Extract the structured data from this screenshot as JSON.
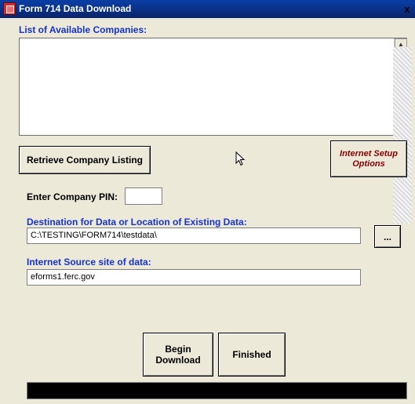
{
  "window": {
    "title": "Form 714 Data Download",
    "close_glyph": "x"
  },
  "companies": {
    "label": "List of Available Companies:"
  },
  "buttons": {
    "retrieve": "Retrieve Company Listing",
    "internet_setup_line1": "Internet Setup",
    "internet_setup_line2": "Options",
    "browse": "...",
    "begin_line1": "Begin",
    "begin_line2": "Download",
    "finished": "Finished"
  },
  "pin": {
    "label": "Enter Company PIN:",
    "value": ""
  },
  "destination": {
    "label": "Destination for Data or Location of Existing Data:",
    "value": "C:\\TESTING\\FORM714\\testdata\\"
  },
  "source": {
    "label": "Internet Source site of data:",
    "value": "eforms1.ferc.gov"
  },
  "colors": {
    "title_bar": "#0a246a",
    "label_blue": "#1433d1",
    "internet_setup_red": "#8a0000",
    "status_bar": "#000000"
  },
  "icons": [
    "app-icon",
    "close-icon",
    "scroll-up-icon",
    "scroll-down-icon",
    "mouse-cursor-icon"
  ]
}
